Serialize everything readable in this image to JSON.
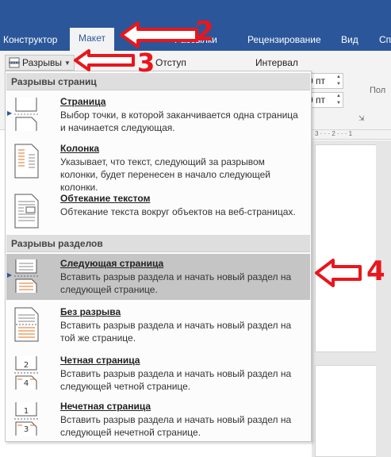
{
  "ribbon": {
    "tabs": [
      "Конструктор",
      "Макет",
      "Рассылки",
      "Рецензирование",
      "Вид",
      "Сп"
    ],
    "active_tab": "Макет",
    "breaks_label": "Разрывы",
    "indent_label": "Отступ",
    "interval_label": "Интервал",
    "spin_values": [
      "0 пт",
      "0 пт"
    ],
    "side_text": "Пол"
  },
  "menu": {
    "page_breaks_header": "Разрывы страниц",
    "section_breaks_header": "Разрывы разделов",
    "items": [
      {
        "title": "Страница",
        "desc": "Выбор точки, в которой заканчивается одна страница и начинается следующая.",
        "icon": "page-break-icon"
      },
      {
        "title": "Колонка",
        "desc": "Указывает, что текст, следующий за разрывом колонки, будет перенесен в начало следующей колонки.",
        "icon": "column-break-icon"
      },
      {
        "title": "Обтекание текстом",
        "desc": "Обтекание текста вокруг объектов на веб-страницах.",
        "icon": "text-wrap-icon"
      },
      {
        "title": "Следующая страница",
        "desc": "Вставить разрыв раздела и начать новый раздел на следующей странице.",
        "icon": "next-page-icon",
        "highlighted": true
      },
      {
        "title": "Без разрыва",
        "desc": "Вставить разрыв раздела и начать новый раздел на той же странице.",
        "icon": "continuous-icon"
      },
      {
        "title": "Четная страница",
        "desc": "Вставить разрыв раздела и начать новый раздел на следующей четной странице.",
        "icon": "even-page-icon"
      },
      {
        "title": "Нечетная страница",
        "desc": "Вставить разрыв раздела и начать новый раздел на следующей нечетной странице.",
        "icon": "odd-page-icon"
      }
    ]
  },
  "annotations": {
    "step2": "2",
    "step3": "3",
    "step4": "4"
  },
  "colors": {
    "ribbon_blue": "#2b579a",
    "arrow_red": "#e8161d",
    "highlight": "#c5c5c5"
  }
}
